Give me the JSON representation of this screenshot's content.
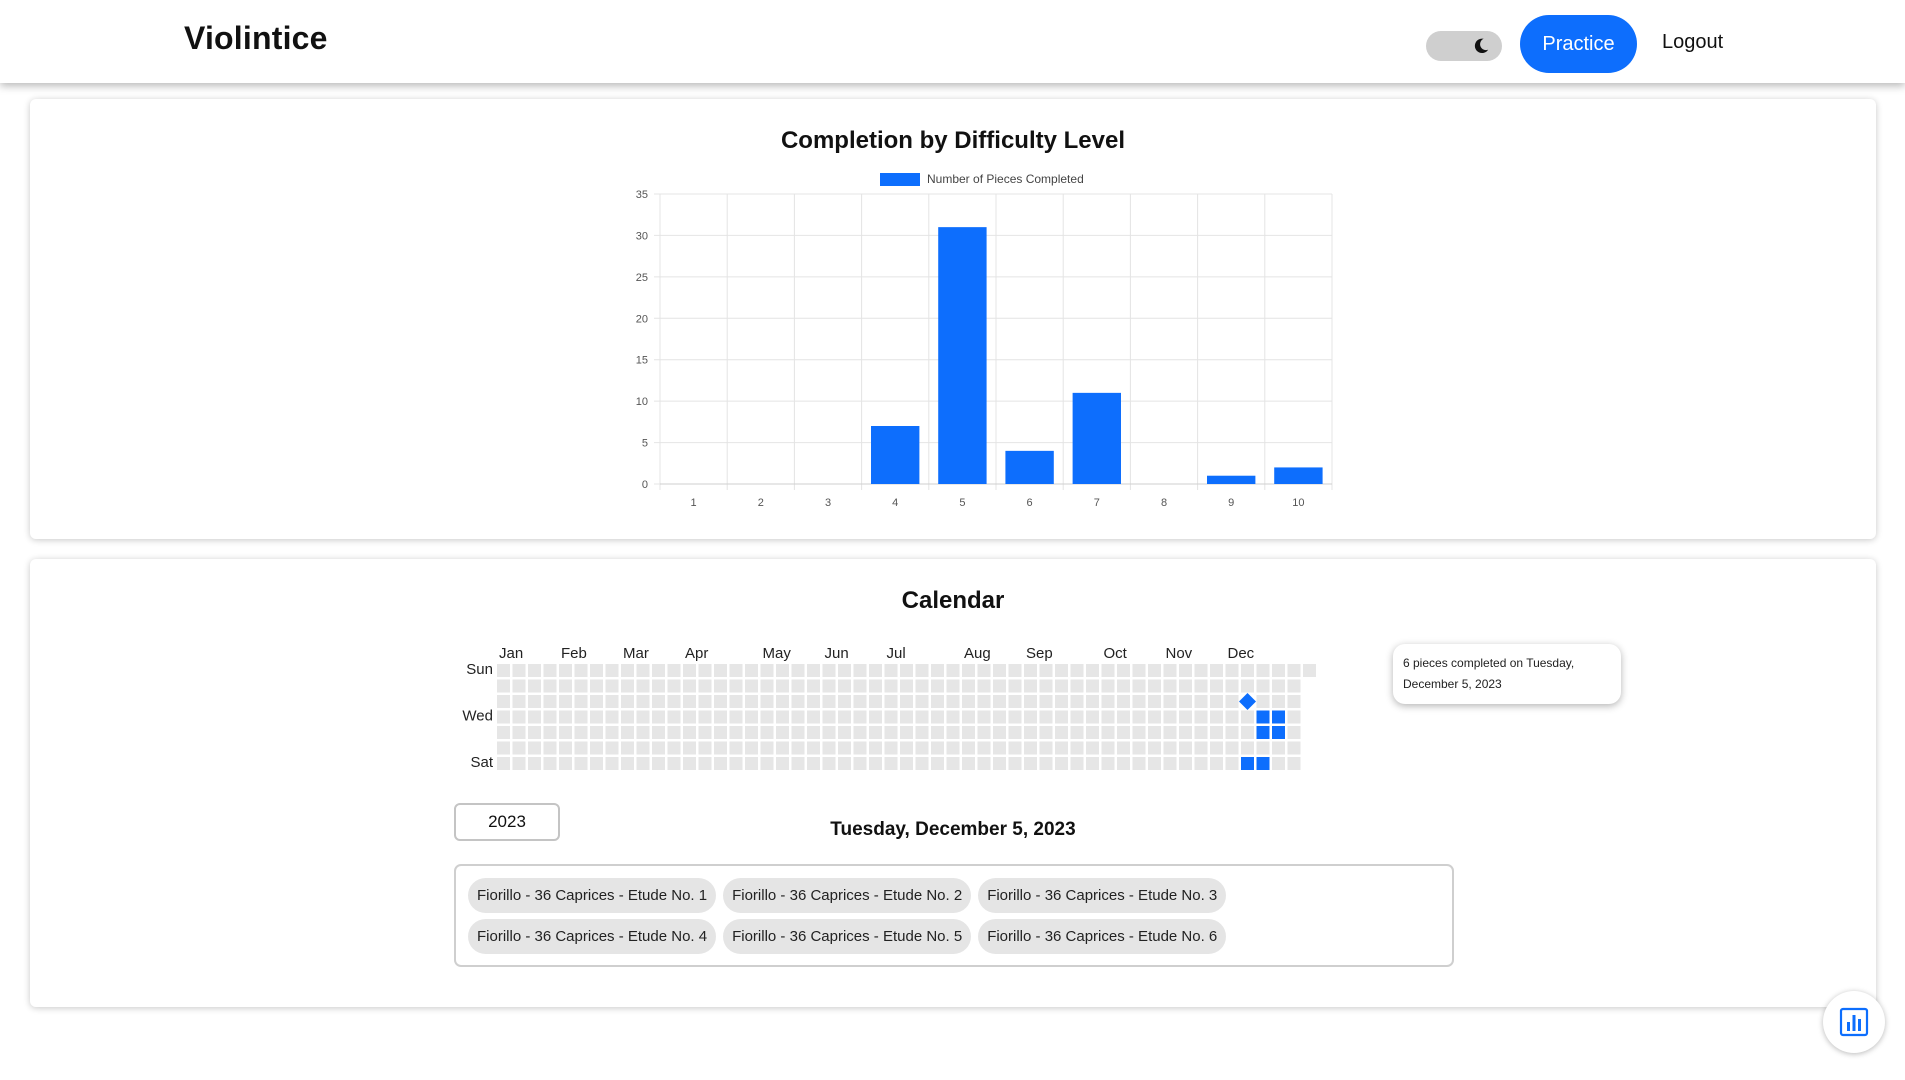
{
  "header": {
    "brand": "Violintice",
    "theme_toggle_icon": "moon-icon",
    "practice_label": "Practice",
    "logout_label": "Logout"
  },
  "chart_data": {
    "type": "bar",
    "title": "Completion by Difficulty Level",
    "categories": [
      "1",
      "2",
      "3",
      "4",
      "5",
      "6",
      "7",
      "8",
      "9",
      "10"
    ],
    "series": [
      {
        "name": "Number of Pieces Completed",
        "values": [
          0,
          0,
          0,
          7,
          31,
          4,
          11,
          0,
          1,
          2
        ],
        "color": "#0d6efd"
      }
    ],
    "yticks": [
      0,
      5,
      10,
      15,
      20,
      25,
      30,
      35
    ],
    "ylim": [
      0,
      35
    ],
    "grid": true,
    "legend": "top-center"
  },
  "calendar": {
    "title": "Calendar",
    "months": [
      "Jan",
      "Feb",
      "Mar",
      "Apr",
      "May",
      "Jun",
      "Jul",
      "Aug",
      "Sep",
      "Oct",
      "Nov",
      "Dec"
    ],
    "weekday_labels": [
      "Sun",
      "Wed",
      "Sat"
    ],
    "active_color": "#0d6efd",
    "empty_color": "#e6e6e6",
    "completed_days": [
      "2023-12-05",
      "2023-12-09",
      "2023-12-13",
      "2023-12-14",
      "2023-12-16",
      "2023-12-20",
      "2023-12-21"
    ],
    "selected_day": "2023-12-05",
    "tooltip": "6 pieces completed on Tuesday, December 5, 2023",
    "year_value": "2023",
    "selected_date_label": "Tuesday, December 5, 2023",
    "pieces": [
      "Fiorillo - 36 Caprices - Etude No. 1",
      "Fiorillo - 36 Caprices - Etude No. 2",
      "Fiorillo - 36 Caprices - Etude No. 3",
      "Fiorillo - 36 Caprices - Etude No. 4",
      "Fiorillo - 36 Caprices - Etude No. 5",
      "Fiorillo - 36 Caprices - Etude No. 6"
    ]
  },
  "fab_icon": "bar-chart-icon"
}
